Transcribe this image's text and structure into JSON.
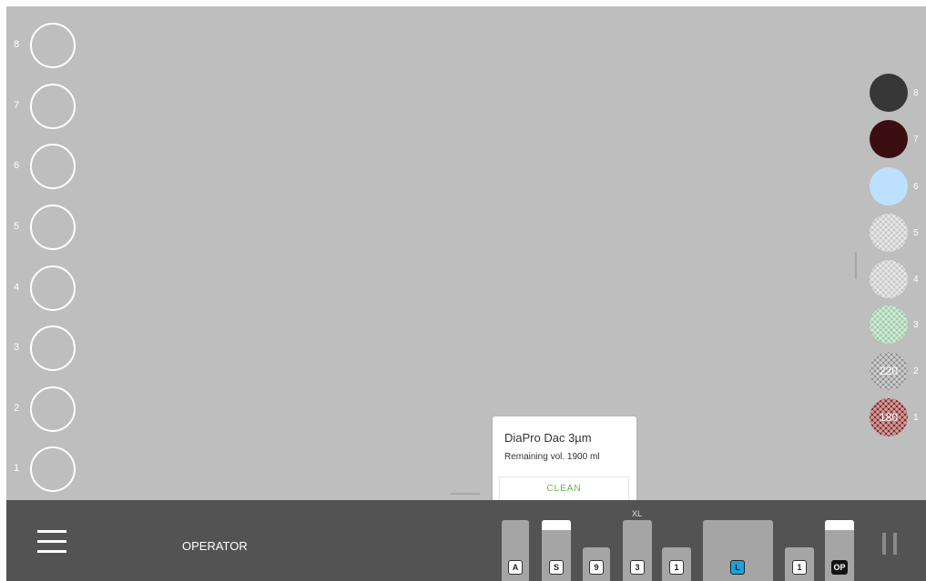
{
  "left_slots": [
    {
      "number": "8"
    },
    {
      "number": "7"
    },
    {
      "number": "6"
    },
    {
      "number": "5"
    },
    {
      "number": "4"
    },
    {
      "number": "3"
    },
    {
      "number": "2"
    },
    {
      "number": "1"
    }
  ],
  "right_slots": [
    {
      "number": "8",
      "color": "#373737",
      "pattern": "solid",
      "value": ""
    },
    {
      "number": "7",
      "color": "#3b0f12",
      "pattern": "solid",
      "value": ""
    },
    {
      "number": "6",
      "color": "#bde0ff",
      "pattern": "solid",
      "value": ""
    },
    {
      "number": "5",
      "color": "#c4c4c4",
      "pattern": "hex",
      "value": ""
    },
    {
      "number": "4",
      "color": "#c4c4c4",
      "pattern": "hex",
      "value": ""
    },
    {
      "number": "3",
      "color": "#98c9a6",
      "pattern": "hex",
      "value": ""
    },
    {
      "number": "2",
      "color": "#8e8e8e",
      "pattern": "hex",
      "value": "220"
    },
    {
      "number": "1",
      "color": "#8c2a2a",
      "pattern": "hex",
      "value": "180"
    }
  ],
  "popup": {
    "title": "DiaPro Dac 3µm",
    "remaining": "Remaining vol. 1900 ml",
    "clean_label": "CLEAN"
  },
  "bottom_bar": {
    "mode_label": "OPERATOR",
    "xl_label": "XL",
    "slots": [
      {
        "badge": "A",
        "fill_level": 0,
        "badge_style": "default"
      },
      {
        "badge": "S",
        "fill_level": 0.84,
        "badge_style": "default"
      },
      {
        "badge": "9",
        "fill_level": 0,
        "badge_style": "default"
      },
      {
        "badge": "3",
        "fill_level": 0,
        "badge_style": "default"
      },
      {
        "badge": "1",
        "fill_level": 0,
        "badge_style": "default"
      },
      {
        "badge": "L",
        "fill_level": 0,
        "badge_style": "selected"
      },
      {
        "badge": "1",
        "fill_level": 0,
        "badge_style": "default"
      },
      {
        "badge": "OP",
        "fill_level": 0.84,
        "badge_style": "dark"
      }
    ]
  },
  "colors": {
    "canvas": "#bebebe",
    "bottom_bar": "#535353",
    "clean_text": "#69b44b",
    "selected_badge": "#1aa3e0"
  },
  "icons": {
    "menu": "hamburger-menu-icon",
    "pause": "pause-icon"
  }
}
